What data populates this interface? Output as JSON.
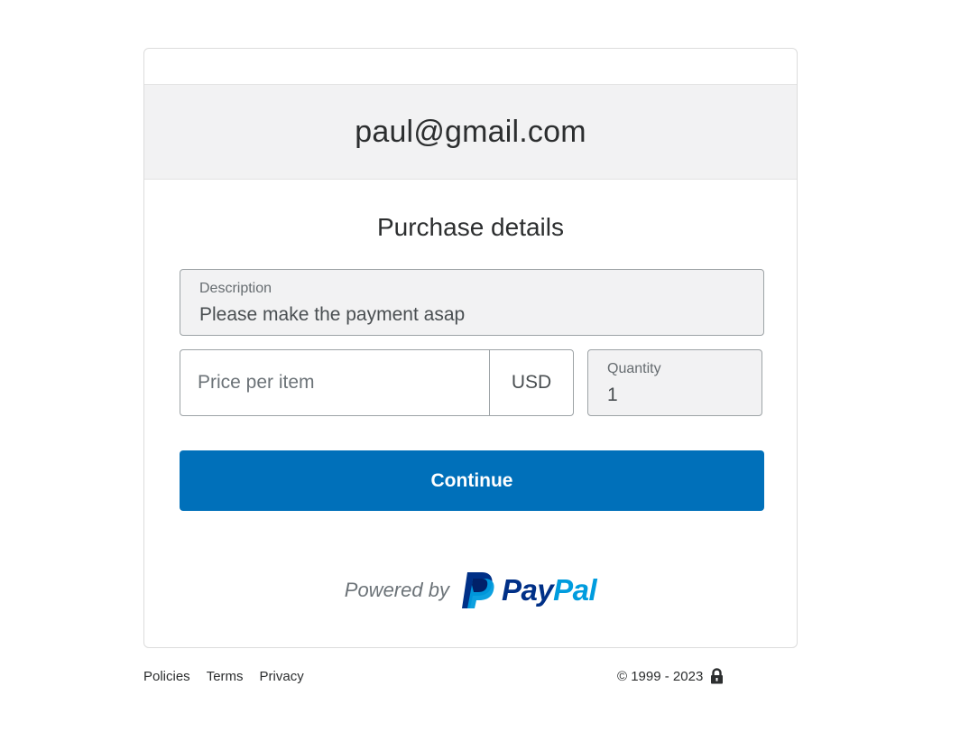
{
  "account": {
    "email": "paul@gmail.com"
  },
  "purchase": {
    "title": "Purchase details",
    "description": {
      "label": "Description",
      "value": "Please make the payment asap"
    },
    "price": {
      "placeholder": "Price per item",
      "value": "",
      "currency": "USD"
    },
    "quantity": {
      "label": "Quantity",
      "value": "1"
    },
    "continue_label": "Continue"
  },
  "branding": {
    "powered_by": "Powered by",
    "paypal_pay": "Pay",
    "paypal_pal": "Pal",
    "logo_icon": "paypal-p-icon",
    "colors": {
      "pay": "#003087",
      "pal": "#009cde",
      "button": "#0070ba"
    }
  },
  "footer": {
    "links": [
      "Policies",
      "Terms",
      "Privacy"
    ],
    "copyright": "© 1999 - 2023",
    "lock_icon": "lock-icon"
  }
}
